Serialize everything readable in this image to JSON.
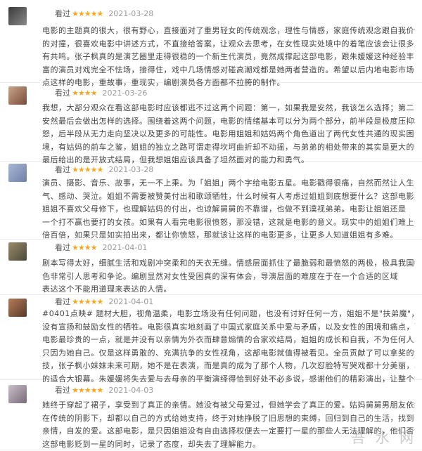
{
  "reviews": [
    {
      "status": "看过",
      "stars": "★★★★★",
      "rating": 5,
      "date": "2021-03-28",
      "avatar_colors": [
        "#3a3a3a",
        "#8a8a8a"
      ],
      "lines": [
        "电影的主题真的很大，很有野心，直接面对了重男轻女的传统观念，理性与情感，家庭传统观念跟自我价值",
        "的对撞，很喜欢电影中讲述方式，不直接给答案，让观众去思考，在女性现实处境中的着笔应该会让很多人",
        "有共鸣。张子枫真的是演艺圈里走得很稳的一个新生代演员，竟然成撑起这部电影，跟朱媛媛这种经验丰",
        "富的演员对戏完全不怯场，接得住，戏中几场情感对碰高潮戏都是她两者营造的。希望以后内地电影市场多",
        "点这样的电影，重故事，重现实，编剧演员各方面都不拉胯的制作。"
      ]
    },
    {
      "status": "看过",
      "stars": "★★★★",
      "rating": 4,
      "date": "2021-03-26",
      "avatar_colors": [
        "#c9a58a",
        "#7a4a3a"
      ],
      "lines": [
        "我想，大部分观众在看这部电影时应该都逃不过这两个问题：第一，如果我是安然，我该怎么选择；第二，",
        "安然最后会做出怎样的选择。围绕着这两个问题，电影的情绪基本可以分为两个部分，前半段是极度压抑和愤",
        "怒，后半段从无力走向坚决以及更多的可能性。电影用姐姐和姑妈两个角色道出了两代女性共通的现实困",
        "境，有姑妈的前车之鉴，姐姐的独立之路可谓走得坎坷曲折却不动摇，与弟弟的相处带来的其实是更大的困境。电影",
        "最后给出的是开放式结局，但我想姐姐应该具备了坦然面对的能力和勇气。"
      ]
    },
    {
      "status": "看过",
      "stars": "★★★★★",
      "rating": 5,
      "date": "2021-03-28",
      "avatar_colors": [
        "#a9b8d4",
        "#6f7fa8"
      ],
      "lines": [
        "演员、摄影、音乐、故事，无一不上乘。为「姐姐」两个字给电影五星。电影戳得很痛，自然而然让人生",
        "气、感动、哭泣。姐姐不需要被赞美付出和歌颂牺牲，什么时候有人考虑过姐姐到底想要什么？这部电影里",
        "姐姐不喜欢父母修下，也理解姑妈的付出，也谅解舅舅的不靠谱，也做不到漠视弟弟。电影让姐姐还是",
        "一个打不赢也要打的女孩。如果有人看完电影很愤怒，那没错，这就是电影的意义。现实中的姐姐们难上千",
        "倍百倍，如果只是如实拍出来，都让你愤怒，那就该让这样的电影更多，让更多人知道姐姐有多难。"
      ]
    },
    {
      "status": "看过",
      "stars": "★★★★",
      "rating": 4,
      "date": "2021-04-01",
      "avatar_colors": [
        "#9a8a6a",
        "#4a4a3a"
      ],
      "lines": [
        "剧本写得太好，细腻生活和戏剧冲突柔和的天衣无缝。情感层面抓住了最脆弱和最愤怒的两极，极具我国特",
        "色非常引人思考和争论。编剧显然对女性受困真的深有体会，导演层面的难度在于在一个合适的区域",
        "表达这个不能用道理来表达的人情。"
      ]
    },
    {
      "status": "看过",
      "stars": "★★★★★",
      "rating": 5,
      "date": "2021-04-01",
      "avatar_colors": [
        "#b57a5a",
        "#5a3a2a"
      ],
      "lines": [
        "#0401点映# 题材大胆，视角温柔，电影立场没有任何问题，也没有讨好任何一方，姐姐不是\"扶弟魔\"，更",
        "没有宣扬和鼓励女性的牺牲。电影很真实地刻画了中国式家庭关系中爱与矛盾，以及女性的困境和痛点，而",
        "电影最珍贵的一点，就是并没有以亲情为外衣而肆意煽情的合家欢结局，姐姐的成长和自我，不为任何人，",
        "只因为她自己。仅是这样勇敢的、充满抗争的女性视角，这部电影就值得被看见。全员贡献了可以拿奖的演",
        "技，张子枫小妹妹未来可期，她不是在表演，而是真的成为了那个人物，几次怼脸特写哭戏都十分美丽，真",
        "的适合大银幕。朱媛媛将失去爱与去母亲的平衡演绎得恰到好处不必多说，感谢他们的精彩演出，让整个故事愈加真实和动人。"
      ]
    },
    {
      "status": "看过",
      "stars": "★★★★★",
      "rating": 5,
      "date": "2021-04-03",
      "avatar_colors": [
        "#c8c0c8",
        "#7a6a7a"
      ],
      "lines": [
        "她终于穿起了裙子，享受到了真正的亲情。她没有被父母爱过，但她学会了真正的爱。姑妈舅舅男朋友依然",
        "在传统的阴影下，却都以自己的方式给她支持，终于对她挣脱了旧思想的束缚，回归到自己的生活，找到了真正的",
        "亲情，自发的爱。这部电影，是只因姐姐没有自由选择权便去一定要打一星的那些人无法理解的，他们否认",
        "这部电影贬到一星的同时，记录了态度，却失去了理解能力。"
      ]
    }
  ],
  "watermark": "吾 水 网"
}
